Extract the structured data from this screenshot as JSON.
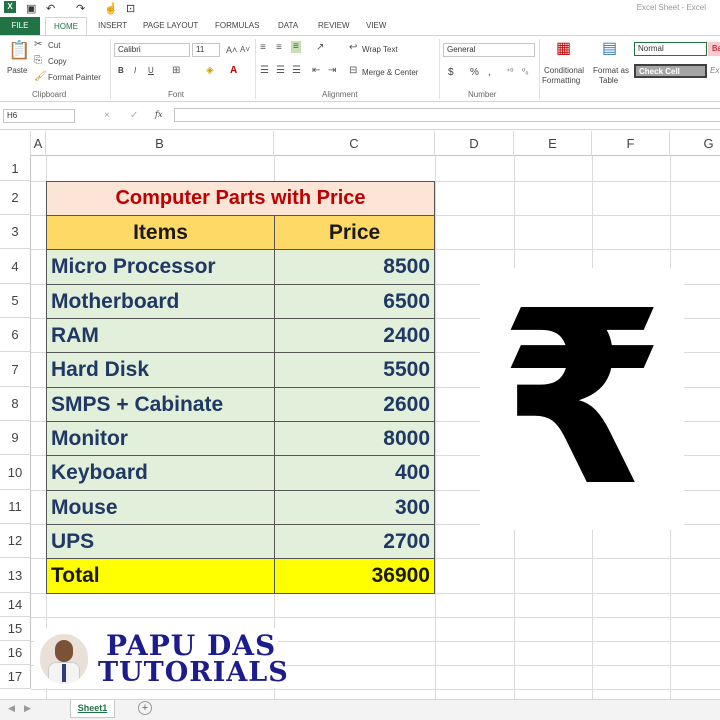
{
  "window": {
    "title": "Excel Sheet - Excel"
  },
  "tabs": [
    "FILE",
    "HOME",
    "INSERT",
    "PAGE LAYOUT",
    "FORMULAS",
    "DATA",
    "REVIEW",
    "VIEW"
  ],
  "ribbon": {
    "clipboard": {
      "paste": "Paste",
      "cut": "Cut",
      "copy": "Copy",
      "format_painter": "Format Painter",
      "label": "Clipboard"
    },
    "font": {
      "name": "Calibri",
      "size": "11",
      "bold": "B",
      "italic": "I",
      "underline": "U",
      "label": "Font"
    },
    "alignment": {
      "wrap": "Wrap Text",
      "merge": "Merge & Center",
      "label": "Alignment"
    },
    "number": {
      "format": "General",
      "currency": "$",
      "percent": "%",
      "comma": ",",
      "label": "Number"
    },
    "styles": {
      "conditional_1": "Conditional",
      "conditional_2": "Formatting",
      "format_as_1": "Format as",
      "format_as_2": "Table",
      "normal": "Normal",
      "check_cell": "Check Cell",
      "bad": "Ba",
      "explanatory": "Ex"
    }
  },
  "formula_bar": {
    "name_box": "H6",
    "cancel": "×",
    "enter": "✓",
    "fx": "fx",
    "value": ""
  },
  "columns": [
    "A",
    "B",
    "C",
    "D",
    "E",
    "F",
    "G"
  ],
  "rows": [
    "1",
    "2",
    "3",
    "4",
    "5",
    "6",
    "7",
    "8",
    "9",
    "10",
    "11",
    "12",
    "13",
    "14",
    "15",
    "16",
    "17"
  ],
  "table": {
    "title": "Computer Parts with Price",
    "headers": [
      "Items",
      "Price"
    ],
    "rows": [
      {
        "item": "Micro Processor",
        "price": "8500"
      },
      {
        "item": "Motherboard",
        "price": "6500"
      },
      {
        "item": "RAM",
        "price": "2400"
      },
      {
        "item": "Hard Disk",
        "price": "5500"
      },
      {
        "item": "SMPS + Cabinate",
        "price": "2600"
      },
      {
        "item": "Monitor",
        "price": "8000"
      },
      {
        "item": "Keyboard",
        "price": "400"
      },
      {
        "item": "Mouse",
        "price": "300"
      },
      {
        "item": "UPS",
        "price": "2700"
      }
    ],
    "total": {
      "label": "Total",
      "value": "36900"
    }
  },
  "image": {
    "symbol": "₹"
  },
  "watermark": {
    "line1": "PAPU DAS",
    "line2": "TUTORIALS"
  },
  "sheets": {
    "active": "Sheet1",
    "add": "+"
  },
  "colors": {
    "title_fill": "#fce4d6",
    "header_fill": "#ffd966",
    "data_fill": "#e2efda",
    "total_fill": "#ffff00",
    "title_text": "#c00000",
    "data_text": "#1f3864",
    "excel_green": "#217346"
  }
}
